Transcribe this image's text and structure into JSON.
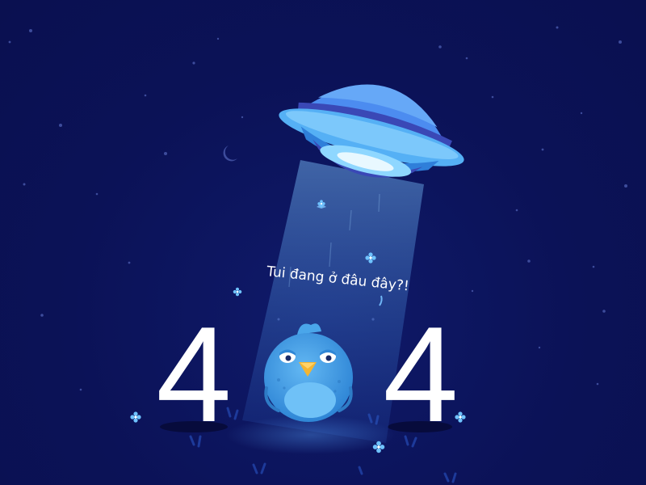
{
  "caption": "Tui đang ở đâu đây?!",
  "error_code": {
    "left_digit": "4",
    "right_digit": "4"
  },
  "colors": {
    "background": "#0b1255",
    "ufo_light": "#5fb8f5",
    "ufo_band": "#3a48b6",
    "bird_body": "#4aa6ea",
    "bird_beak": "#f3b533",
    "text": "#ffffff"
  },
  "illustration": {
    "elements": [
      "ufo",
      "light-beam",
      "bird-character",
      "crescent-moon-icon",
      "star-icons",
      "flower-icons",
      "grass-tufts"
    ]
  }
}
